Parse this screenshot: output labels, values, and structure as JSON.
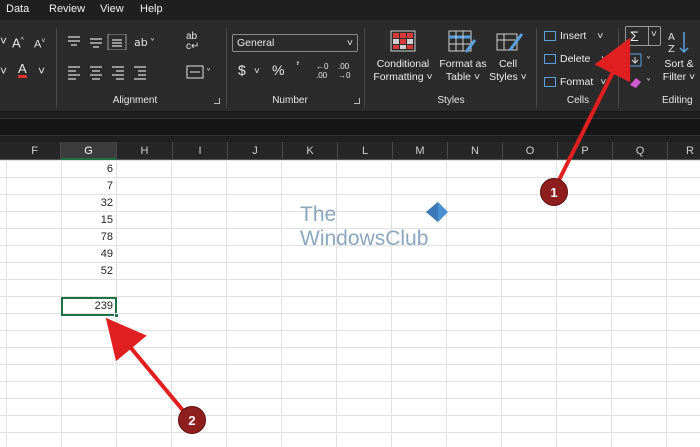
{
  "menu": [
    "Data",
    "Review",
    "View",
    "Help"
  ],
  "ribbon": {
    "alignment_label": "Alignment",
    "number_label": "Number",
    "number_format": "General",
    "styles_label": "Styles",
    "conditional": [
      "Conditional",
      "Formatting ˅"
    ],
    "format_as_table": [
      "Format as",
      "Table ˅"
    ],
    "cell_styles": [
      "Cell",
      "Styles ˅"
    ],
    "cells_label": "Cells",
    "insert": "Insert",
    "delete": "Delete",
    "format": "Format",
    "editing_label": "Editing",
    "sort_filter": [
      "Sort &",
      "Filter ˅"
    ],
    "currency_symbol": "$",
    "percent_symbol": "%",
    "comma_symbol": "ʼ",
    "autosum_symbol": "Σ"
  },
  "columns": [
    "F",
    "G",
    "H",
    "I",
    "J",
    "K",
    "L",
    "M",
    "N",
    "O",
    "P",
    "Q",
    "R"
  ],
  "selected_column": "G",
  "cells_g": [
    "6",
    "7",
    "32",
    "15",
    "78",
    "49",
    "52"
  ],
  "sum_cell": "239",
  "watermark": [
    "The",
    "WindowsClub"
  ],
  "badges": [
    "1",
    "2"
  ],
  "colors": {
    "arrow": "#e02020",
    "badge": "#8f1e1e",
    "selection": "#1e7145"
  }
}
